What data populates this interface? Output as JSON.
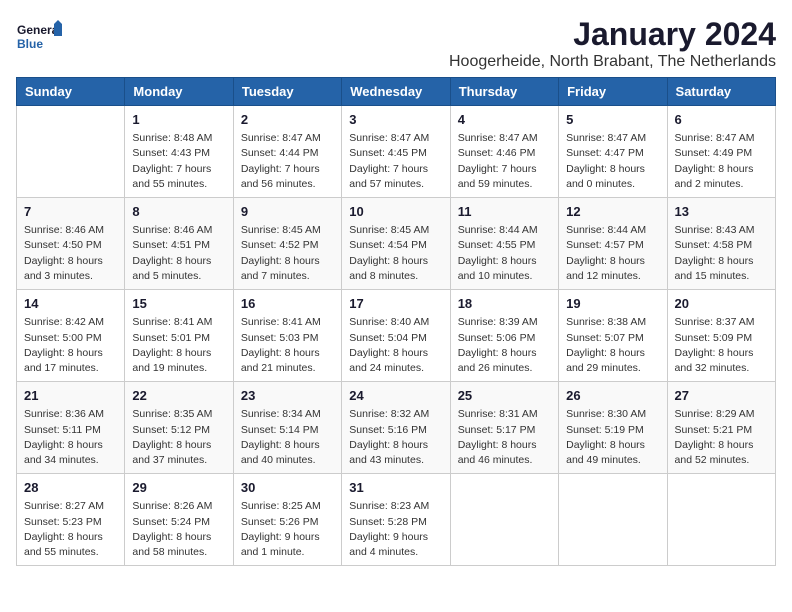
{
  "logo": {
    "line1": "General",
    "line2": "Blue"
  },
  "title": "January 2024",
  "subtitle": "Hoogerheide, North Brabant, The Netherlands",
  "header": {
    "accent_color": "#2563a8"
  },
  "columns": [
    "Sunday",
    "Monday",
    "Tuesday",
    "Wednesday",
    "Thursday",
    "Friday",
    "Saturday"
  ],
  "weeks": [
    [
      {
        "day": "",
        "info": ""
      },
      {
        "day": "1",
        "info": "Sunrise: 8:48 AM\nSunset: 4:43 PM\nDaylight: 7 hours\nand 55 minutes."
      },
      {
        "day": "2",
        "info": "Sunrise: 8:47 AM\nSunset: 4:44 PM\nDaylight: 7 hours\nand 56 minutes."
      },
      {
        "day": "3",
        "info": "Sunrise: 8:47 AM\nSunset: 4:45 PM\nDaylight: 7 hours\nand 57 minutes."
      },
      {
        "day": "4",
        "info": "Sunrise: 8:47 AM\nSunset: 4:46 PM\nDaylight: 7 hours\nand 59 minutes."
      },
      {
        "day": "5",
        "info": "Sunrise: 8:47 AM\nSunset: 4:47 PM\nDaylight: 8 hours\nand 0 minutes."
      },
      {
        "day": "6",
        "info": "Sunrise: 8:47 AM\nSunset: 4:49 PM\nDaylight: 8 hours\nand 2 minutes."
      }
    ],
    [
      {
        "day": "7",
        "info": "Sunrise: 8:46 AM\nSunset: 4:50 PM\nDaylight: 8 hours\nand 3 minutes."
      },
      {
        "day": "8",
        "info": "Sunrise: 8:46 AM\nSunset: 4:51 PM\nDaylight: 8 hours\nand 5 minutes."
      },
      {
        "day": "9",
        "info": "Sunrise: 8:45 AM\nSunset: 4:52 PM\nDaylight: 8 hours\nand 7 minutes."
      },
      {
        "day": "10",
        "info": "Sunrise: 8:45 AM\nSunset: 4:54 PM\nDaylight: 8 hours\nand 8 minutes."
      },
      {
        "day": "11",
        "info": "Sunrise: 8:44 AM\nSunset: 4:55 PM\nDaylight: 8 hours\nand 10 minutes."
      },
      {
        "day": "12",
        "info": "Sunrise: 8:44 AM\nSunset: 4:57 PM\nDaylight: 8 hours\nand 12 minutes."
      },
      {
        "day": "13",
        "info": "Sunrise: 8:43 AM\nSunset: 4:58 PM\nDaylight: 8 hours\nand 15 minutes."
      }
    ],
    [
      {
        "day": "14",
        "info": "Sunrise: 8:42 AM\nSunset: 5:00 PM\nDaylight: 8 hours\nand 17 minutes."
      },
      {
        "day": "15",
        "info": "Sunrise: 8:41 AM\nSunset: 5:01 PM\nDaylight: 8 hours\nand 19 minutes."
      },
      {
        "day": "16",
        "info": "Sunrise: 8:41 AM\nSunset: 5:03 PM\nDaylight: 8 hours\nand 21 minutes."
      },
      {
        "day": "17",
        "info": "Sunrise: 8:40 AM\nSunset: 5:04 PM\nDaylight: 8 hours\nand 24 minutes."
      },
      {
        "day": "18",
        "info": "Sunrise: 8:39 AM\nSunset: 5:06 PM\nDaylight: 8 hours\nand 26 minutes."
      },
      {
        "day": "19",
        "info": "Sunrise: 8:38 AM\nSunset: 5:07 PM\nDaylight: 8 hours\nand 29 minutes."
      },
      {
        "day": "20",
        "info": "Sunrise: 8:37 AM\nSunset: 5:09 PM\nDaylight: 8 hours\nand 32 minutes."
      }
    ],
    [
      {
        "day": "21",
        "info": "Sunrise: 8:36 AM\nSunset: 5:11 PM\nDaylight: 8 hours\nand 34 minutes."
      },
      {
        "day": "22",
        "info": "Sunrise: 8:35 AM\nSunset: 5:12 PM\nDaylight: 8 hours\nand 37 minutes."
      },
      {
        "day": "23",
        "info": "Sunrise: 8:34 AM\nSunset: 5:14 PM\nDaylight: 8 hours\nand 40 minutes."
      },
      {
        "day": "24",
        "info": "Sunrise: 8:32 AM\nSunset: 5:16 PM\nDaylight: 8 hours\nand 43 minutes."
      },
      {
        "day": "25",
        "info": "Sunrise: 8:31 AM\nSunset: 5:17 PM\nDaylight: 8 hours\nand 46 minutes."
      },
      {
        "day": "26",
        "info": "Sunrise: 8:30 AM\nSunset: 5:19 PM\nDaylight: 8 hours\nand 49 minutes."
      },
      {
        "day": "27",
        "info": "Sunrise: 8:29 AM\nSunset: 5:21 PM\nDaylight: 8 hours\nand 52 minutes."
      }
    ],
    [
      {
        "day": "28",
        "info": "Sunrise: 8:27 AM\nSunset: 5:23 PM\nDaylight: 8 hours\nand 55 minutes."
      },
      {
        "day": "29",
        "info": "Sunrise: 8:26 AM\nSunset: 5:24 PM\nDaylight: 8 hours\nand 58 minutes."
      },
      {
        "day": "30",
        "info": "Sunrise: 8:25 AM\nSunset: 5:26 PM\nDaylight: 9 hours\nand 1 minute."
      },
      {
        "day": "31",
        "info": "Sunrise: 8:23 AM\nSunset: 5:28 PM\nDaylight: 9 hours\nand 4 minutes."
      },
      {
        "day": "",
        "info": ""
      },
      {
        "day": "",
        "info": ""
      },
      {
        "day": "",
        "info": ""
      }
    ]
  ]
}
